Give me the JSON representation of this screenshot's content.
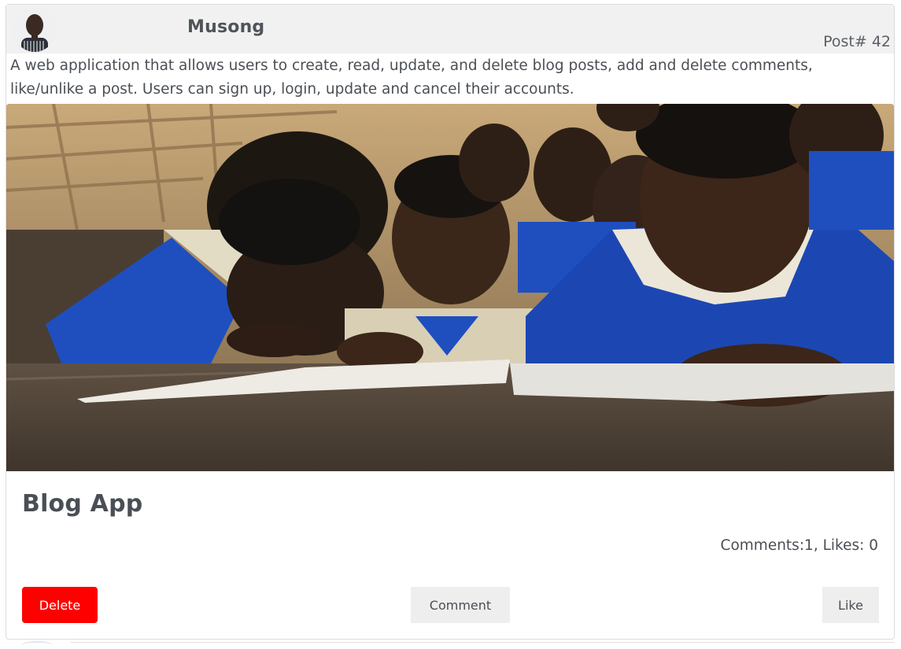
{
  "post": {
    "author": "Musong",
    "post_number": "Post# 42",
    "description": "A web application that allows users to create, read, update, and delete blog posts, add and delete comments, like/unlike a post. Users can sign up, login, update and cancel their accounts.",
    "title": "Blog App",
    "stats": "Comments:1, Likes: 0",
    "image": "photo-children-reading-classroom"
  },
  "actions": {
    "delete_label": "Delete",
    "comment_label": "Comment",
    "like_label": "Like"
  },
  "colors": {
    "delete_button": "#ff0000",
    "secondary_button": "#eeeeee",
    "header_background": "#f1f1f1",
    "text": "#4a4f55"
  }
}
